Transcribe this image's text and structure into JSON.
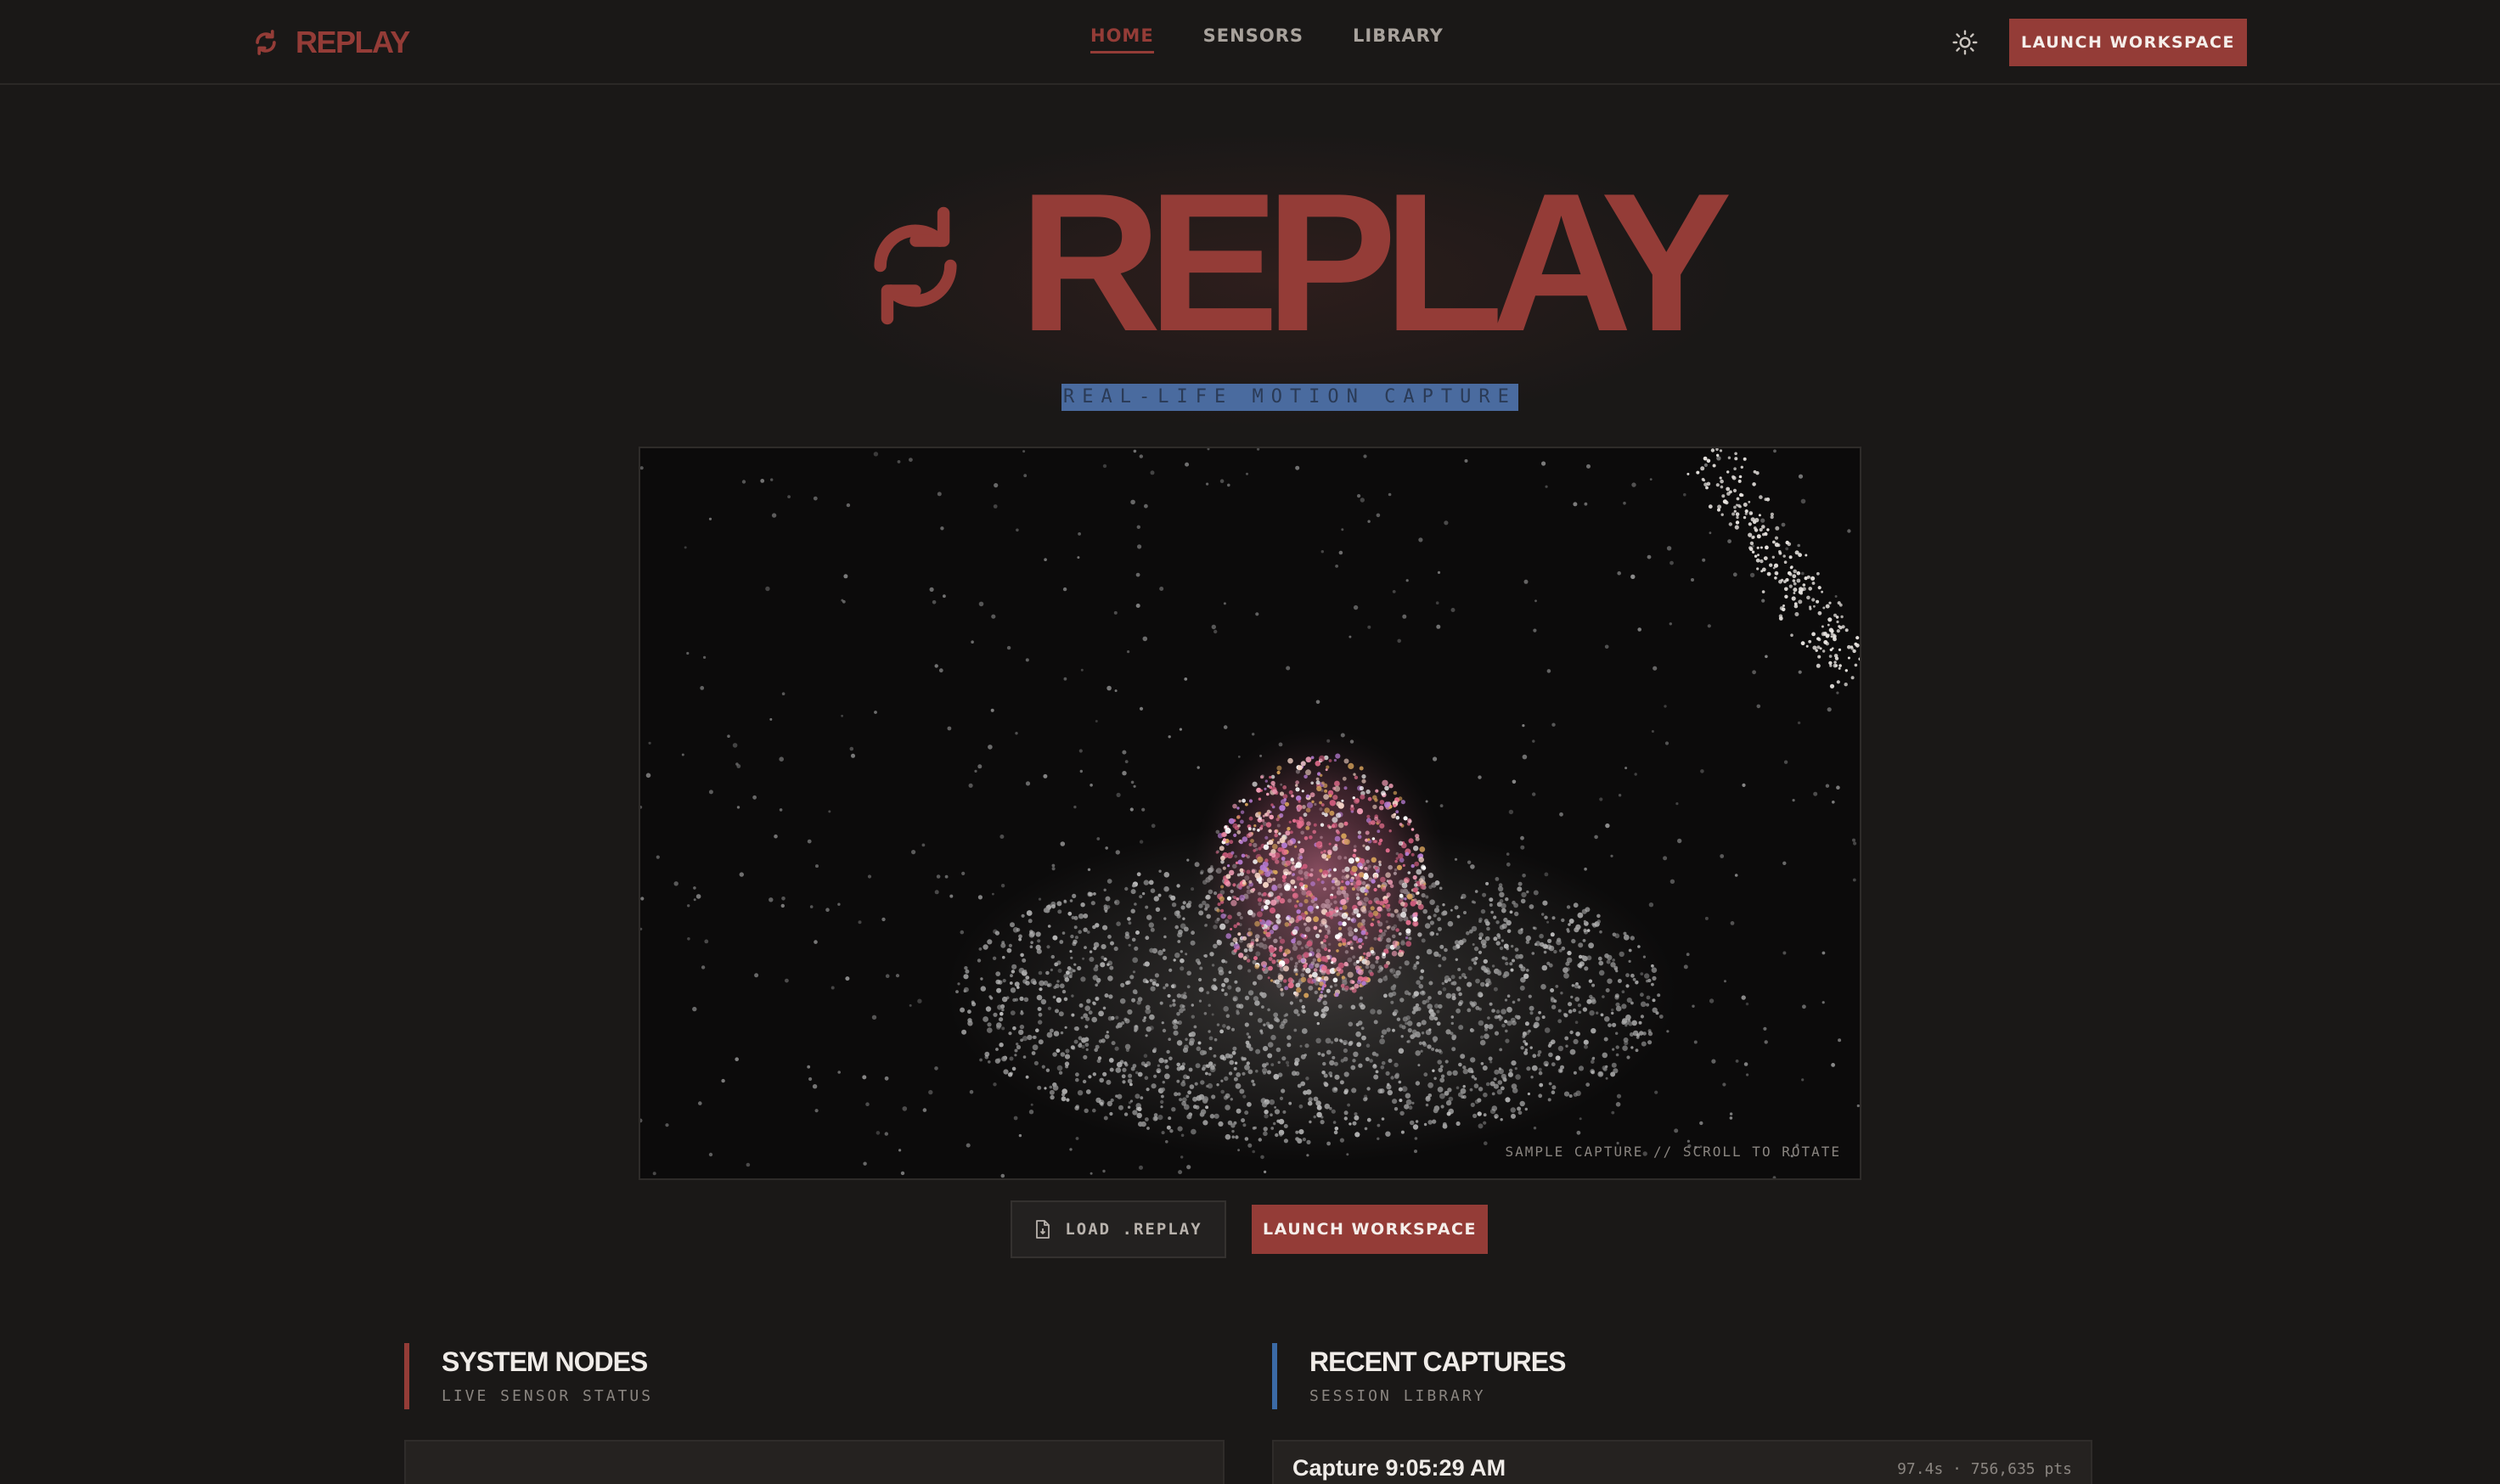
{
  "brand": {
    "name": "REPLAY",
    "icon": "refresh-icon"
  },
  "nav": {
    "links": [
      {
        "label": "HOME",
        "active": true
      },
      {
        "label": "SENSORS",
        "active": false
      },
      {
        "label": "LIBRARY",
        "active": false
      }
    ],
    "theme_icon": "sun-icon",
    "cta_label": "LAUNCH WORKSPACE"
  },
  "hero": {
    "title": "REPLAY",
    "tagline": "REAL-LIFE MOTION CAPTURE",
    "icon": "refresh-icon"
  },
  "viewer": {
    "caption": "SAMPLE CAPTURE // SCROLL TO ROTATE"
  },
  "actions": {
    "load_label": "LOAD .REPLAY",
    "load_icon": "file-icon",
    "launch_label": "LAUNCH WORKSPACE"
  },
  "sections": {
    "nodes": {
      "title": "SYSTEM NODES",
      "subtitle": "LIVE SENSOR STATUS"
    },
    "captures": {
      "title": "RECENT CAPTURES",
      "subtitle": "SESSION LIBRARY",
      "items": [
        {
          "title": "Capture 9:05:29 AM",
          "meta": "97.4s · 756,635 pts"
        }
      ]
    }
  },
  "colors": {
    "accent": "#943c37",
    "accent_blue": "#3b6aa6",
    "background": "#1a1817",
    "highlight": "#4a6b9f"
  }
}
